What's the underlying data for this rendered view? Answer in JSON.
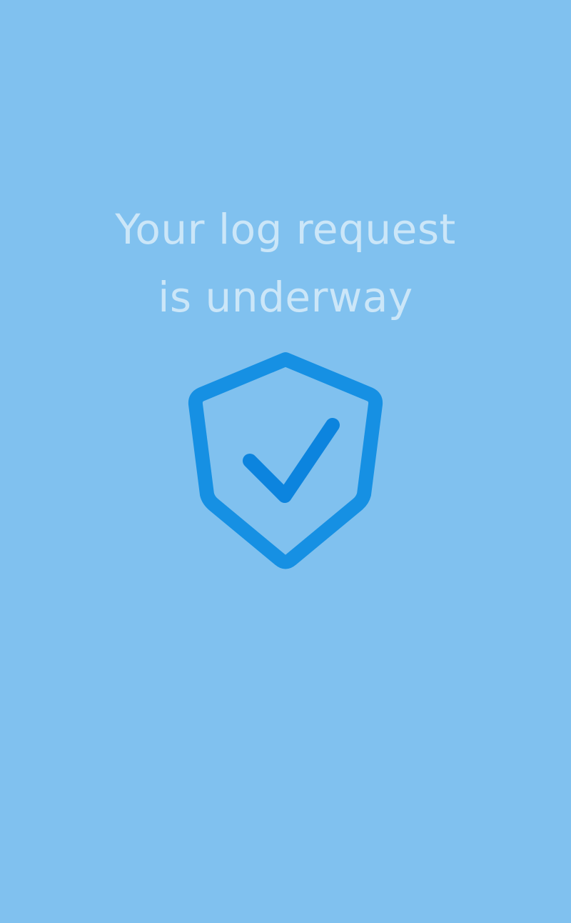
{
  "screen": {
    "title_lines": [
      "Your log request",
      "is underway"
    ]
  },
  "icons": {
    "status_icon": "shield-check-icon"
  },
  "colors": {
    "background": "#80c1ef",
    "title_text": "#cbe6f8",
    "icon_shield": "#1690e3",
    "icon_check": "#0c84de"
  }
}
